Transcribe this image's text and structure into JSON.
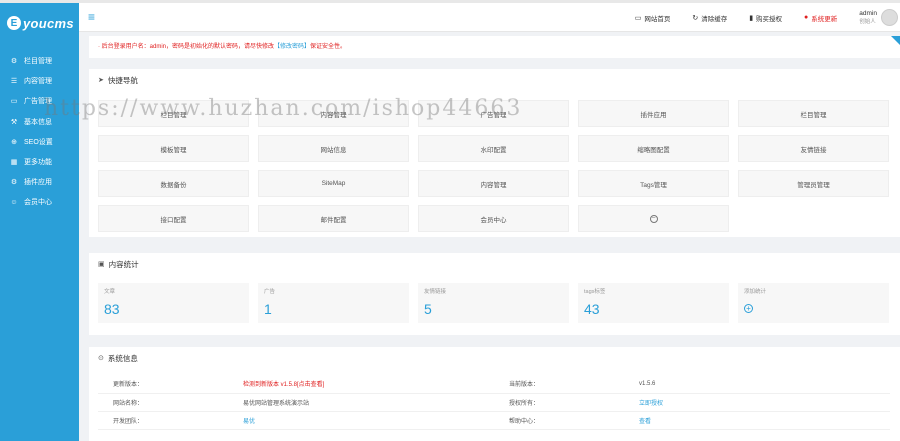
{
  "brand": {
    "mark": "E",
    "name": "youcms"
  },
  "sidebar": {
    "items": [
      {
        "icon": "⚙",
        "label": "栏目管理"
      },
      {
        "icon": "☰",
        "label": "内容管理"
      },
      {
        "icon": "▭",
        "label": "广告管理"
      },
      {
        "icon": "⚒",
        "label": "基本信息"
      },
      {
        "icon": "⊕",
        "label": "SEO设置"
      },
      {
        "icon": "▦",
        "label": "更多功能"
      },
      {
        "icon": "⚙",
        "label": "插件应用"
      },
      {
        "icon": "☺",
        "label": "会员中心"
      }
    ]
  },
  "header": {
    "links": [
      {
        "icon": "▭",
        "label": "网站首页"
      },
      {
        "icon": "↻",
        "label": "清除缓存"
      },
      {
        "icon": "▮",
        "label": "购买授权"
      },
      {
        "icon": "●",
        "label": "系统更新"
      }
    ],
    "user": {
      "name": "admin",
      "role": "创始人"
    }
  },
  "notice": {
    "text": "· 后台登录用户名：admin，密码是初始化的默认密码，请尽快修改",
    "link_text": "【修改密码】",
    "suffix": "保证安全性。"
  },
  "quick": {
    "title": "快捷导航",
    "items": [
      "栏目管理",
      "内容管理",
      "广告管理",
      "插件应用",
      "栏目管理",
      "模板管理",
      "网站信息",
      "水印配置",
      "缩略图配置",
      "友情链接",
      "数据备份",
      "SiteMap",
      "内容管理",
      "Tags管理",
      "管理员管理",
      "接口配置",
      "邮件配置",
      "会员中心"
    ]
  },
  "stats": {
    "title": "内容统计",
    "cards": [
      {
        "label": "文章",
        "value": "83"
      },
      {
        "label": "广告",
        "value": "1"
      },
      {
        "label": "友情链接",
        "value": "5"
      },
      {
        "label": "tags标签",
        "value": "43"
      },
      {
        "label": "添加统计",
        "value": ""
      }
    ]
  },
  "system": {
    "title": "系统信息",
    "rows": [
      {
        "k1": "更新版本：",
        "v1": "检测到新版本 v1.5.8[点击查看]",
        "k2": "当前版本：",
        "v2": "v1.5.6"
      },
      {
        "k1": "网站名称：",
        "v1": "易优网站管理系统演示站",
        "k2": "授权所有：",
        "v2": "立即授权"
      },
      {
        "k1": "开发团队：",
        "v1": "易优",
        "k2": "帮助中心：",
        "v2": "查看"
      }
    ]
  },
  "watermark": "https://www.huzhan.com/ishop44663",
  "colors": {
    "accent": "#2a9fd8",
    "warn": "#e02020"
  }
}
